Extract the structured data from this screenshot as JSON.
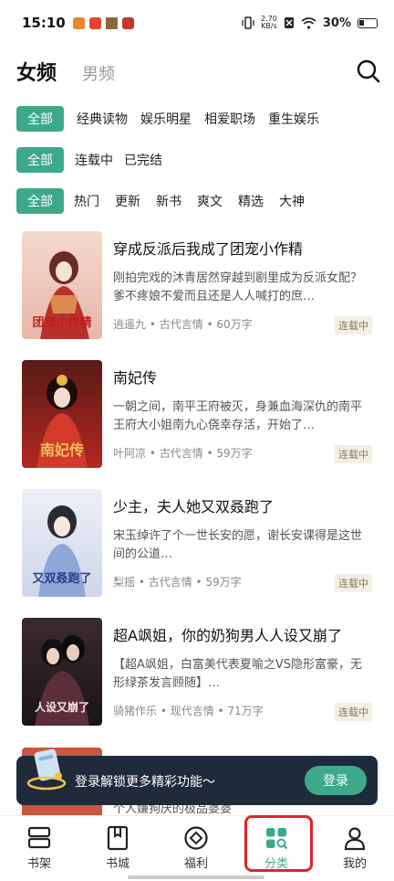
{
  "status_bar": {
    "time": "15:10",
    "net_speed_value": "2.70",
    "net_speed_unit": "KB/s",
    "battery": "30%"
  },
  "header": {
    "tab_active": "女频",
    "tab_other": "男频"
  },
  "filters": {
    "row1": [
      "全部",
      "经典读物",
      "娱乐明星",
      "相爱职场",
      "重生娱乐"
    ],
    "row2": [
      "全部",
      "连载中",
      "已完结"
    ],
    "row3": [
      "全部",
      "热门",
      "更新",
      "新书",
      "爽文",
      "精选",
      "大神"
    ]
  },
  "books": [
    {
      "title": "穿成反派后我成了团宠小作精",
      "desc": "刚拍完戏的沐青居然穿越到剧里成为反派女配？爹不疼娘不爱而且还是人人喊打的庶…",
      "meta": "逍遥九 • 古代言情 • 60万字",
      "status": "连载中",
      "cover_text": "团宠小作精"
    },
    {
      "title": "南妃传",
      "desc": "一朝之间，南平王府被灭，身兼血海深仇的南平王府大小姐南九心侥幸存活，开始了…",
      "meta": "叶阿凉 • 古代言情 • 59万字",
      "status": "连载中",
      "cover_text": "南妃传"
    },
    {
      "title": "少主，夫人她又双叒跑了",
      "desc": "宋玉绰许了个一世长安的愿，谢长安课得是这世间的公道…",
      "meta": "梨摇 • 古代言情 • 59万字",
      "status": "连载中",
      "cover_text": "又双叒跑了"
    },
    {
      "title": "超A飒姐，你的奶狗男人人设又崩了",
      "desc": "【超A飒姐，白富美代表夏喻之VS隐形富豪，无形绿茶发言顾随】…",
      "meta": "骑猪作乐 • 现代言情 • 71万字",
      "status": "连载中",
      "cover_text": "人设又崩了"
    },
    {
      "title": "",
      "desc": "个人嫌狗厌的极品婆婆",
      "meta": "",
      "status": "",
      "cover_text": ""
    }
  ],
  "login_banner": {
    "text": "登录解锁更多精彩功能～",
    "button": "登录"
  },
  "bottom_nav": [
    {
      "label": "书架",
      "icon": "bookshelf-icon"
    },
    {
      "label": "书城",
      "icon": "bookstore-icon"
    },
    {
      "label": "福利",
      "icon": "welfare-icon"
    },
    {
      "label": "分类",
      "icon": "category-icon"
    },
    {
      "label": "我的",
      "icon": "profile-icon"
    }
  ],
  "colors": {
    "accent": "#3ea98a",
    "banner_bg": "#1f2b3b",
    "highlight": "#e0262a"
  }
}
